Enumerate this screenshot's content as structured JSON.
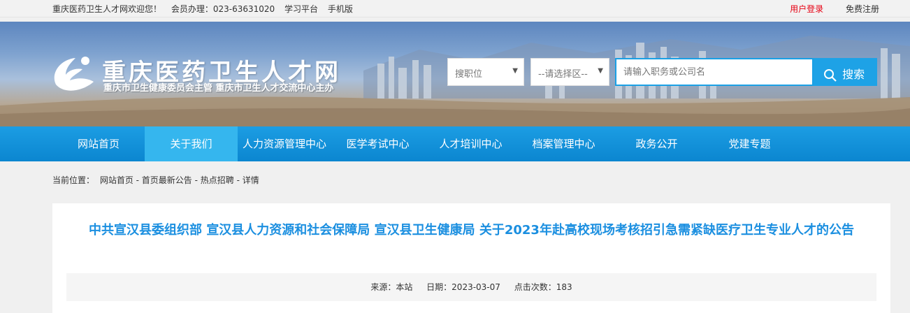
{
  "topbar": {
    "welcome": "重庆医药卫生人才网欢迎您！",
    "member": "会员办理：023-63631020",
    "study": "学习平台",
    "mobile": "手机版",
    "login": "用户登录",
    "register": "免费注册"
  },
  "header": {
    "title": "重庆医药卫生人才网",
    "subtitle": "重庆市卫生健康委员会主管  重庆市卫生人才交流中心主办",
    "job_select": "搜职位",
    "region_select": "--请选择区--",
    "search_placeholder": "请输入职务或公司名",
    "search_button": "搜索"
  },
  "nav": {
    "items": [
      {
        "label": "网站首页"
      },
      {
        "label": "关于我们"
      },
      {
        "label": "人力资源管理中心"
      },
      {
        "label": "医学考试中心"
      },
      {
        "label": "人才培训中心"
      },
      {
        "label": "档案管理中心"
      },
      {
        "label": "政务公开"
      },
      {
        "label": "党建专题"
      }
    ]
  },
  "breadcrumb": {
    "prefix": "当前位置：",
    "path": "网站首页 - 首页最新公告 - 热点招聘 - 详情"
  },
  "article": {
    "title": "中共宣汉县委组织部 宣汉县人力资源和社会保障局 宣汉县卫生健康局 关于2023年赴高校现场考核招引急需紧缺医疗卫生专业人才的公告",
    "source": "来源：本站",
    "date": "日期：2023-03-07",
    "views": "点击次数：183"
  },
  "colors": {
    "accent": "#1b8fe0",
    "nav_bg": "#0b86d0",
    "nav_active": "#35b6ee",
    "login": "#e60012"
  }
}
